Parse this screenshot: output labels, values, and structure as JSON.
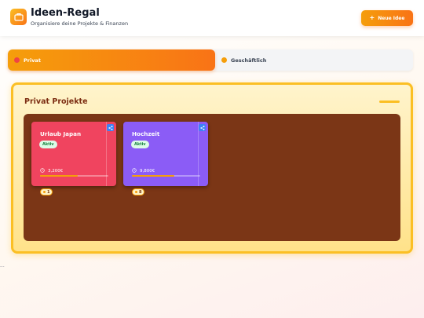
{
  "header": {
    "title": "Ideen-Regal",
    "subtitle": "Organisiere deine Projekte & Finanzen",
    "logo_icon": "briefcase-icon",
    "new_button": {
      "icon": "+",
      "label": "Neue Idee"
    }
  },
  "tabs": [
    {
      "label": "Privat",
      "active": true,
      "dot_color": "#ef4444"
    },
    {
      "label": "Geschäftlich",
      "active": false,
      "dot_color": "#f59e0b"
    }
  ],
  "section": {
    "title": "Privat Projekte",
    "cards": [
      {
        "title": "Urlaub Japan",
        "status": "Aktiv",
        "budget": "3,200€",
        "progress": 0.55,
        "color": "#f0445f",
        "progress_color": "#f59e0b",
        "count": "1"
      },
      {
        "title": "Hochzeit",
        "status": "Aktiv",
        "budget": "9,800€",
        "progress": 0.62,
        "color": "#8b5cf6",
        "progress_color": "#f59e0b",
        "count": "8"
      }
    ]
  },
  "footer": {
    "text": "..."
  }
}
